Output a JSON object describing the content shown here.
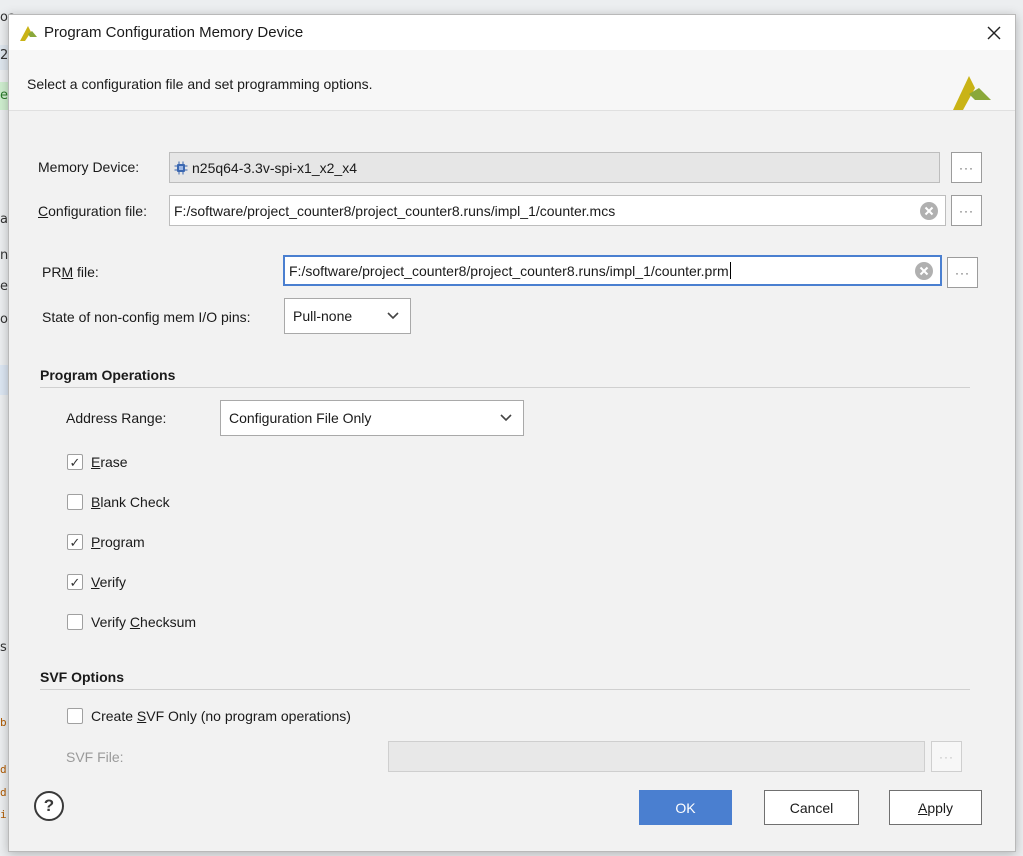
{
  "window": {
    "title": "Program Configuration Memory Device",
    "description": "Select a configuration file and set programming options."
  },
  "background_fragments": [
    "oa",
    "2",
    "e",
    "at",
    "n",
    "e",
    "og",
    "s",
    "b",
    "d",
    "d",
    "i"
  ],
  "form": {
    "memory_device_label": "Memory Device:",
    "memory_device_value": "n25q64-3.3v-spi-x1_x2_x4",
    "config_file_label": "Configuration file:",
    "config_file_value": "F:/software/project_counter8/project_counter8.runs/impl_1/counter.mcs",
    "prm_file_label": "PRM file:",
    "prm_file_value": "F:/software/project_counter8/project_counter8.runs/impl_1/counter.prm",
    "io_pins_label": "State of non-config mem I/O pins:",
    "io_pins_value": "Pull-none",
    "browse_label": "···"
  },
  "program_operations": {
    "title": "Program Operations",
    "address_range_label": "Address Range:",
    "address_range_value": "Configuration File Only",
    "options": [
      {
        "label": "Erase",
        "checked": true
      },
      {
        "label": "Blank Check",
        "checked": false
      },
      {
        "label": "Program",
        "checked": true
      },
      {
        "label": "Verify",
        "checked": true
      },
      {
        "label": "Verify Checksum",
        "checked": false
      }
    ]
  },
  "svf_options": {
    "title": "SVF Options",
    "create_svf_label": "Create SVF Only (no program operations)",
    "create_svf_checked": false,
    "svf_file_label": "SVF File:",
    "svf_file_value": ""
  },
  "buttons": {
    "help": "?",
    "ok": "OK",
    "cancel": "Cancel",
    "apply": "Apply"
  },
  "colors": {
    "primary": "#4a7fd0",
    "logo_yellow": "#c9b316",
    "logo_green": "#8aa83a"
  }
}
